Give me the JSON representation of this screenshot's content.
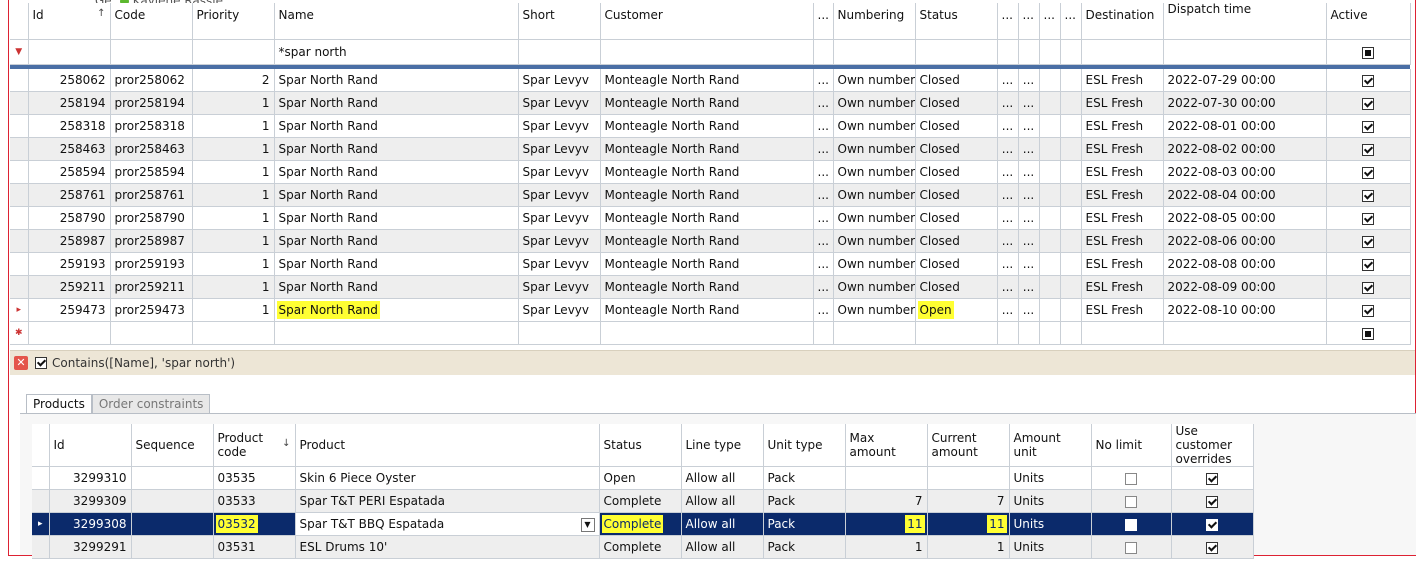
{
  "top_cut_text": "Kaylene Rassie",
  "orders_grid": {
    "columns": [
      "Id",
      "Code",
      "Priority",
      "Name",
      "Short",
      "Customer",
      "...",
      "Numbering",
      "Status",
      "...",
      "...",
      "...",
      "...",
      "Destination",
      "Dispatch time",
      "Active"
    ],
    "filter": {
      "name": "*spar north"
    },
    "rows": [
      {
        "id": "258062",
        "code": "pror258062",
        "priority": "2",
        "name": "Spar North Rand",
        "short": "Spar Levyv",
        "customer": "Monteagle North Rand",
        "numbering": "Own numbers",
        "status": "Closed",
        "destination": "ESL Fresh",
        "dispatch": "2022-07-29 00:00"
      },
      {
        "id": "258194",
        "code": "pror258194",
        "priority": "1",
        "name": "Spar North Rand",
        "short": "Spar Levyv",
        "customer": "Monteagle North Rand",
        "numbering": "Own numbers",
        "status": "Closed",
        "destination": "ESL Fresh",
        "dispatch": "2022-07-30 00:00"
      },
      {
        "id": "258318",
        "code": "pror258318",
        "priority": "1",
        "name": "Spar North Rand",
        "short": "Spar Levyv",
        "customer": "Monteagle North Rand",
        "numbering": "Own numbers",
        "status": "Closed",
        "destination": "ESL Fresh",
        "dispatch": "2022-08-01 00:00"
      },
      {
        "id": "258463",
        "code": "pror258463",
        "priority": "1",
        "name": "Spar North Rand",
        "short": "Spar Levyv",
        "customer": "Monteagle North Rand",
        "numbering": "Own numbers",
        "status": "Closed",
        "destination": "ESL Fresh",
        "dispatch": "2022-08-02 00:00"
      },
      {
        "id": "258594",
        "code": "pror258594",
        "priority": "1",
        "name": "Spar North Rand",
        "short": "Spar Levyv",
        "customer": "Monteagle North Rand",
        "numbering": "Own numbers",
        "status": "Closed",
        "destination": "ESL Fresh",
        "dispatch": "2022-08-03 00:00"
      },
      {
        "id": "258761",
        "code": "pror258761",
        "priority": "1",
        "name": "Spar North Rand",
        "short": "Spar Levyv",
        "customer": "Monteagle North Rand",
        "numbering": "Own numbers",
        "status": "Closed",
        "destination": "ESL Fresh",
        "dispatch": "2022-08-04 00:00"
      },
      {
        "id": "258790",
        "code": "pror258790",
        "priority": "1",
        "name": "Spar North Rand",
        "short": "Spar Levyv",
        "customer": "Monteagle North Rand",
        "numbering": "Own numbers",
        "status": "Closed",
        "destination": "ESL Fresh",
        "dispatch": "2022-08-05 00:00"
      },
      {
        "id": "258987",
        "code": "pror258987",
        "priority": "1",
        "name": "Spar North Rand",
        "short": "Spar Levyv",
        "customer": "Monteagle North Rand",
        "numbering": "Own numbers",
        "status": "Closed",
        "destination": "ESL Fresh",
        "dispatch": "2022-08-06 00:00"
      },
      {
        "id": "259193",
        "code": "pror259193",
        "priority": "1",
        "name": "Spar North Rand",
        "short": "Spar Levyv",
        "customer": "Monteagle North Rand",
        "numbering": "Own numbers",
        "status": "Closed",
        "destination": "ESL Fresh",
        "dispatch": "2022-08-08 00:00"
      },
      {
        "id": "259211",
        "code": "pror259211",
        "priority": "1",
        "name": "Spar North Rand",
        "short": "Spar Levyv",
        "customer": "Monteagle North Rand",
        "numbering": "Own numbers",
        "status": "Closed",
        "destination": "ESL Fresh",
        "dispatch": "2022-08-09 00:00"
      },
      {
        "id": "259473",
        "code": "pror259473",
        "priority": "1",
        "name": "Spar North Rand",
        "short": "Spar Levyv",
        "customer": "Monteagle North Rand",
        "numbering": "Own numbers",
        "status": "Open",
        "destination": "ESL Fresh",
        "dispatch": "2022-08-10 00:00"
      }
    ]
  },
  "filter_bar": {
    "expression": "Contains([Name], 'spar north')"
  },
  "tabs": [
    "Products",
    "Order constraints"
  ],
  "products_grid": {
    "columns": [
      "Id",
      "Sequence",
      "Product code",
      "Product",
      "Status",
      "Line type",
      "Unit type",
      "Max amount",
      "Current amount",
      "Amount unit",
      "No limit",
      "Use customer overrides"
    ],
    "rows": [
      {
        "id": "3299310",
        "sequence": "",
        "code": "03535",
        "product": "Skin 6 Piece Oyster",
        "status": "Open",
        "line": "Allow all",
        "unit": "Pack",
        "max": "",
        "current": "",
        "amount_unit": "Units",
        "no_limit": false,
        "override": true
      },
      {
        "id": "3299309",
        "sequence": "",
        "code": "03533",
        "product": "Spar T&T PERI Espatada",
        "status": "Complete",
        "line": "Allow all",
        "unit": "Pack",
        "max": "7",
        "current": "7",
        "amount_unit": "Units",
        "no_limit": false,
        "override": true
      },
      {
        "id": "3299308",
        "sequence": "",
        "code": "03532",
        "product": "Spar T&T BBQ Espatada",
        "status": "Complete",
        "line": "Allow all",
        "unit": "Pack",
        "max": "11",
        "current": "11",
        "amount_unit": "Units",
        "no_limit": false,
        "override": true
      },
      {
        "id": "3299291",
        "sequence": "",
        "code": "03531",
        "product": "ESL Drums 10'",
        "status": "Complete",
        "line": "Allow all",
        "unit": "Pack",
        "max": "1",
        "current": "1",
        "amount_unit": "Units",
        "no_limit": false,
        "override": true
      }
    ]
  },
  "colors": {
    "selection": "#0b2a6b",
    "highlight": "#ffff33",
    "filter_bar": "#ede6d6"
  }
}
